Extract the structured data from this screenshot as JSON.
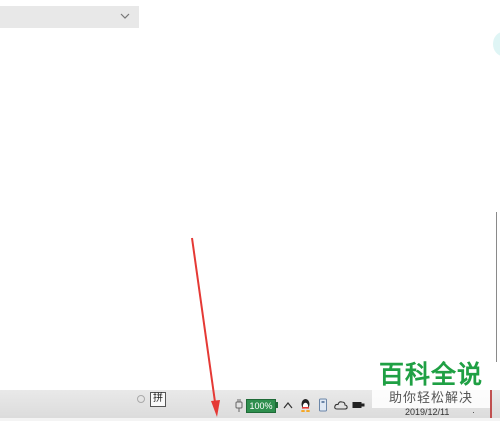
{
  "tray": {
    "ime_label": "拼",
    "battery_percent": "100%",
    "date": "2019/12/11"
  },
  "watermark": {
    "title": "百科全说",
    "subtitle": "助你轻松解决"
  },
  "icons": {
    "dropdown": "chevron-down-icon",
    "plug": "plug-icon",
    "caret": "caret-up-icon",
    "qq": "qq-penguin-icon",
    "usb": "usb-drive-icon",
    "cloud": "cloud-icon",
    "speaker": "speaker-icon"
  },
  "colors": {
    "battery": "#2f8f4e",
    "arrow": "#e53935",
    "watermark": "#1fa044"
  }
}
